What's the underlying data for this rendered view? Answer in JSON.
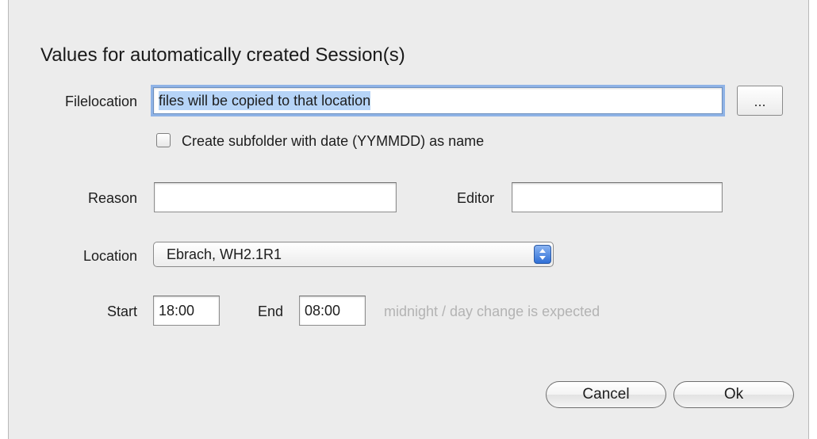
{
  "dialog": {
    "heading": "Values for automatically created Session(s)",
    "filelocation": {
      "label": "Filelocation",
      "value": "files will be copied to that location",
      "browse_label": "..."
    },
    "subfolder_checkbox": {
      "label": "Create subfolder with date (YYMMDD) as name",
      "checked": false
    },
    "reason": {
      "label": "Reason",
      "value": ""
    },
    "editor": {
      "label": "Editor",
      "value": ""
    },
    "location": {
      "label": "Location",
      "selected": "Ebrach, WH2.1R1"
    },
    "start": {
      "label": "Start",
      "value": "18:00"
    },
    "end": {
      "label": "End",
      "value": "08:00"
    },
    "hint": "midnight / day change is expected",
    "buttons": {
      "cancel": "Cancel",
      "ok": "Ok"
    }
  },
  "colors": {
    "dialog_bg": "#ececec",
    "focus_ring": "#8fb3e6",
    "selection": "#b6d4f7",
    "hint_text": "#b3b3b3",
    "popup_accent": "#2f6fd6"
  },
  "icons": {
    "checkbox": "checkbox-unchecked-icon",
    "popup": "up-down-arrows-icon"
  }
}
